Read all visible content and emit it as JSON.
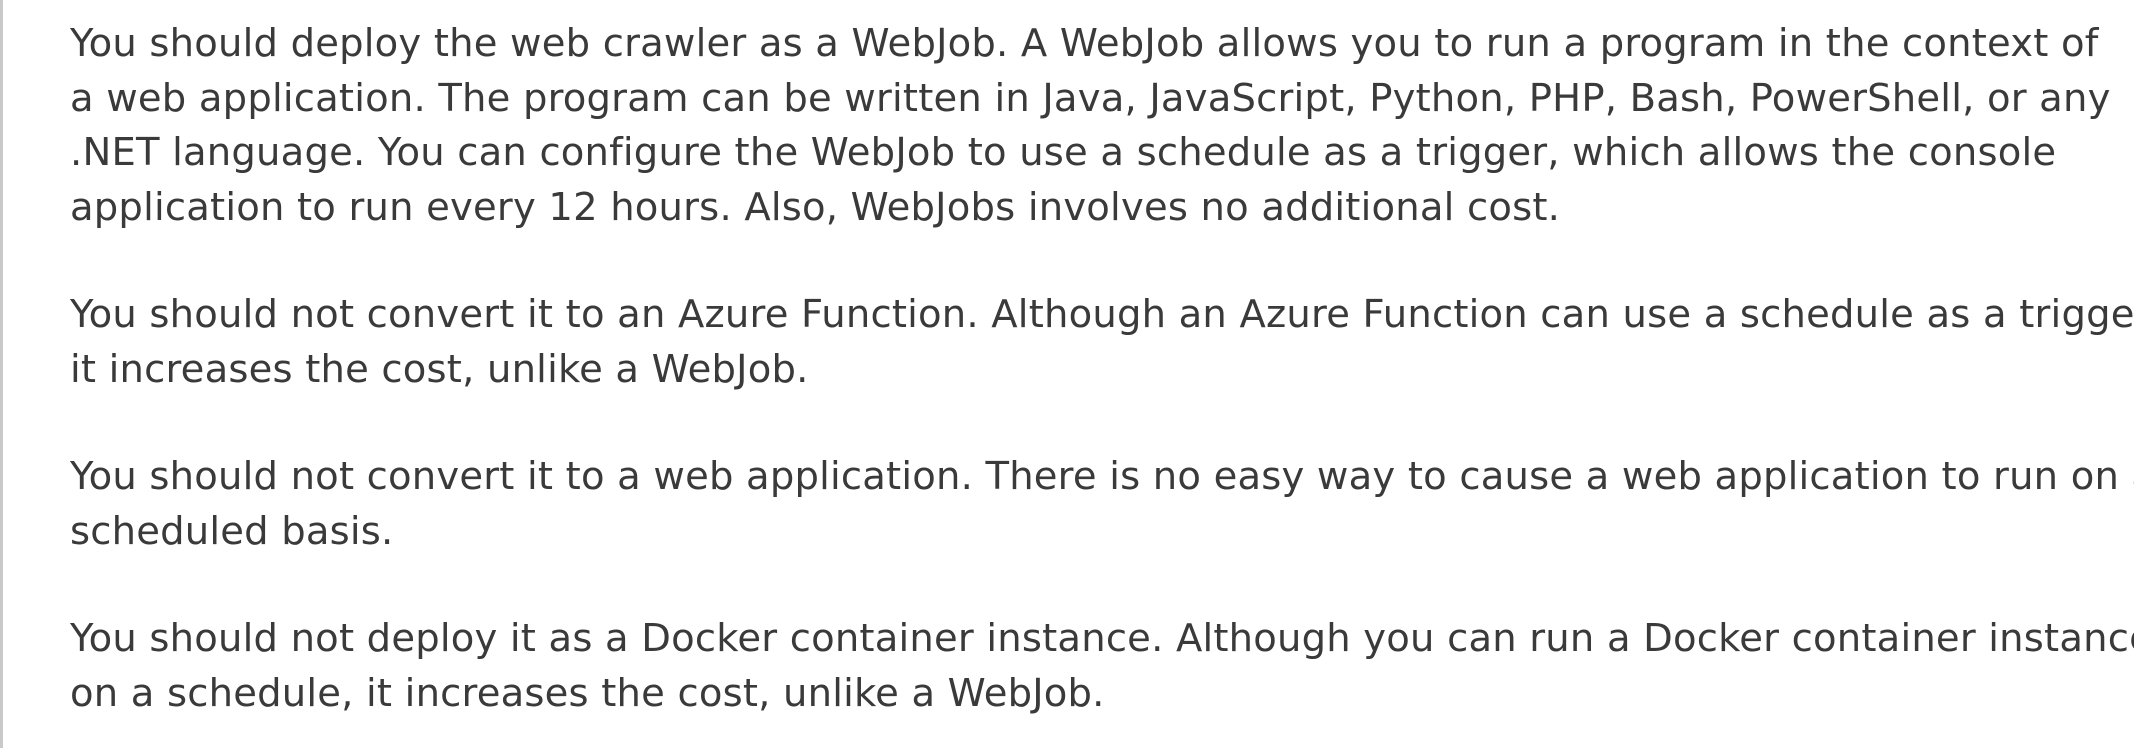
{
  "explanation": {
    "paragraphs": [
      {
        "lines": [
          "You should deploy the web crawler as a WebJob. A WebJob allows you to run a program in the context of",
          "a web application. The program can be written in Java, JavaScript, Python, PHP, Bash, PowerShell, or any",
          ".NET language. You can configure the WebJob to use a schedule as a trigger, which allows the console",
          "application to run every 12 hours. Also, WebJobs involves no additional cost."
        ]
      },
      {
        "lines": [
          "You should not convert it to an Azure Function. Although an Azure Function can use a schedule as a trigger,",
          "it increases the cost, unlike a WebJob."
        ]
      },
      {
        "lines": [
          "You should not convert it to a web application. There is no easy way to cause a web application to run on a",
          "scheduled basis."
        ]
      },
      {
        "lines": [
          "You should not deploy it as a Docker container instance. Although you can run a Docker container instance",
          "on a schedule, it increases the cost, unlike a WebJob."
        ]
      }
    ]
  },
  "colors": {
    "text": "#3a3a3a",
    "background": "#ffffff",
    "left_rule": "#c9c9c9"
  }
}
